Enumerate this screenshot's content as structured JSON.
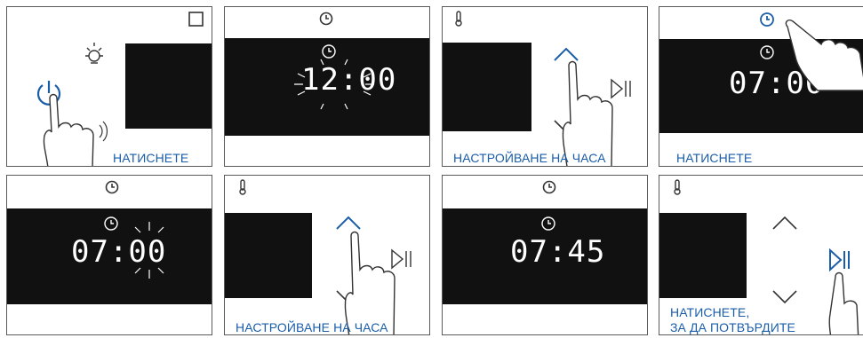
{
  "steps": [
    {
      "caption": "НАТИСНЕТЕ"
    },
    {
      "time": "12:00"
    },
    {
      "caption": "НАСТРОЙВАНЕ НА ЧАСА"
    },
    {
      "time": "07:00",
      "caption": "НАТИСНЕТЕ"
    },
    {
      "time": "07:00"
    },
    {
      "caption": "НАСТРОЙВАНЕ НА ЧАСА"
    },
    {
      "time": "07:45"
    },
    {
      "caption_line1": "НАТИСНЕТЕ,",
      "caption_line2": "ЗА ДА ПОТВЪРДИТЕ"
    }
  ],
  "colors": {
    "accent": "#1a5da8",
    "display": "#111111",
    "border": "#5a5a5a"
  },
  "icons": [
    "stop-square-icon",
    "power-icon",
    "light-icon",
    "clock-icon",
    "thermometer-icon",
    "up-arrow-icon",
    "down-arrow-icon",
    "play-pause-icon",
    "hand-pointer-icon"
  ]
}
